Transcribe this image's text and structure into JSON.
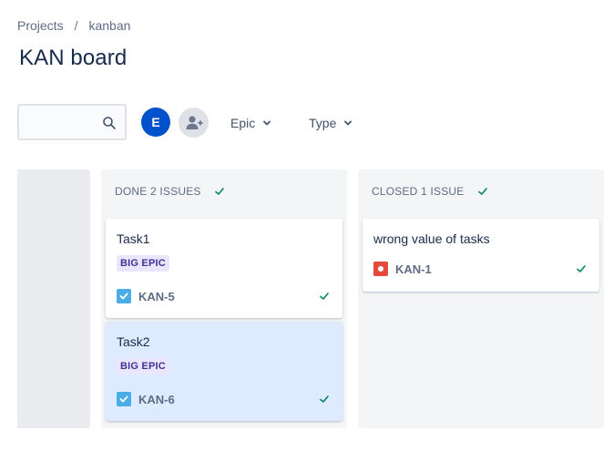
{
  "breadcrumb": {
    "project": "Projects",
    "separator": "/",
    "current": "kanban"
  },
  "page": {
    "title": "KAN board"
  },
  "search": {
    "value": "",
    "placeholder": ""
  },
  "toolbar": {
    "avatar_initial": "E",
    "filters": [
      {
        "label": "Epic"
      },
      {
        "label": "Type"
      }
    ]
  },
  "colors": {
    "accent": "#0052cc",
    "done_green": "#00875a",
    "epic_bg": "#eae6ff",
    "epic_text": "#403294",
    "selected_card": "#deebff"
  },
  "columns": [
    {
      "header": "DONE 2 ISSUES",
      "cards": [
        {
          "title": "Task1",
          "epic": "BIG EPIC",
          "type": "task",
          "key": "KAN-5",
          "selected": false
        },
        {
          "title": "Task2",
          "epic": "BIG EPIC",
          "type": "task",
          "key": "KAN-6",
          "selected": true
        }
      ]
    },
    {
      "header": "CLOSED 1 ISSUE",
      "cards": [
        {
          "title": "wrong value of tasks",
          "epic": "",
          "type": "bug",
          "key": "KAN-1",
          "selected": false
        }
      ]
    }
  ]
}
